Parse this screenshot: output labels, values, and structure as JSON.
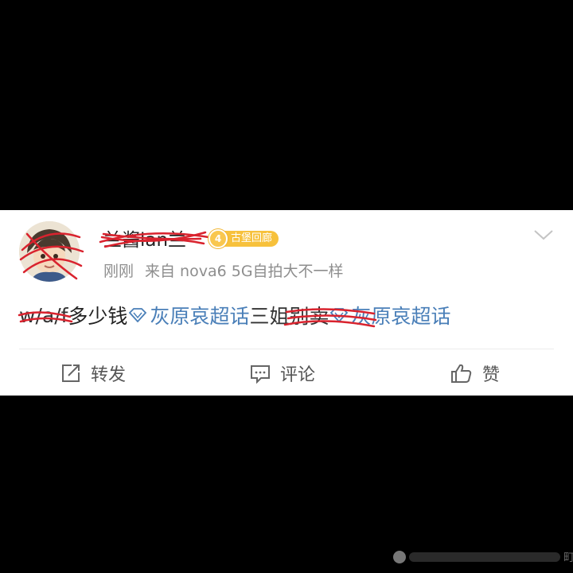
{
  "post": {
    "username": "兰酱lan兰",
    "badge": {
      "level": "4",
      "label": "古堡回廊"
    },
    "meta": {
      "time": "刚刚",
      "source": "来自 nova6 5G自拍大不一样"
    },
    "content": {
      "prefix_redacted": "w/a/f",
      "text": " 多少钱",
      "topic1": "灰原哀超话",
      "middle_redacted": "三姐别卖",
      "topic2": "灰原哀超话"
    },
    "actions": {
      "repost": "转发",
      "comment": "评论",
      "like": "赞"
    }
  },
  "watermark": {
    "trail": "町"
  },
  "colors": {
    "background": "#000000",
    "card": "#ffffff",
    "topic_link": "#4a7fb8",
    "badge": "#f7c13c",
    "scribble": "#d9232e",
    "meta_text": "#8e8e8e"
  },
  "icons": {
    "chevron": "chevron-down-icon",
    "repost": "repost-icon",
    "comment": "comment-icon",
    "like": "thumbs-up-icon",
    "topic": "diamond-icon"
  }
}
